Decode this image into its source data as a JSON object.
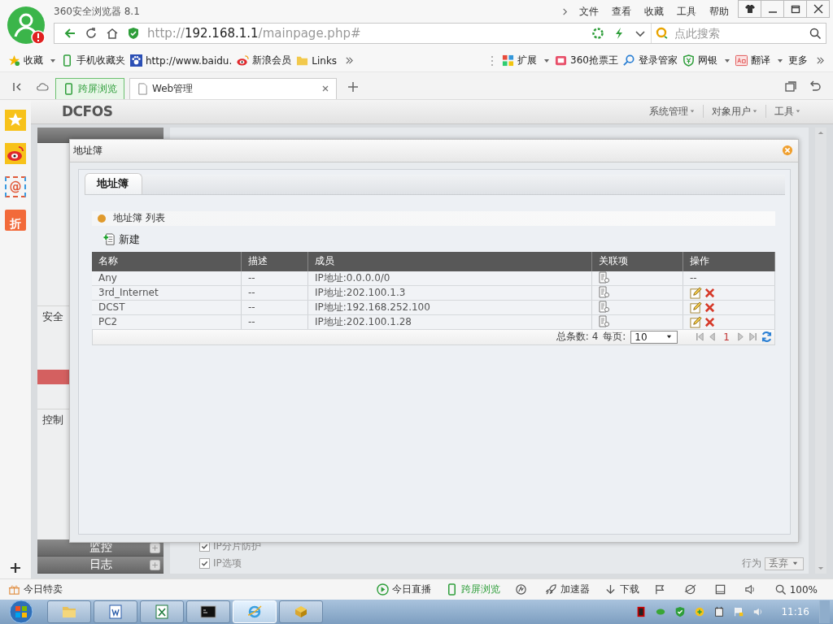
{
  "browser": {
    "title": "360安全浏览器 8.1",
    "menu": [
      "文件",
      "查看",
      "收藏",
      "工具",
      "帮助"
    ]
  },
  "address": {
    "scheme": "http://",
    "host": "192.168.1.1",
    "path": "/mainpage.php#"
  },
  "search": {
    "placeholder": "点此搜索"
  },
  "bookmarks": [
    {
      "label": "收藏",
      "kind": "favorites"
    },
    {
      "label": "手机收藏夹",
      "kind": "phone"
    },
    {
      "label": "http://www.baidu.",
      "kind": "paw"
    },
    {
      "label": "新浪会员",
      "kind": "weibo"
    },
    {
      "label": "Links",
      "kind": "folder"
    }
  ],
  "extensions": [
    {
      "label": "扩展",
      "kind": "apps"
    },
    {
      "label": "360抢票王",
      "kind": "ticket"
    },
    {
      "label": "登录管家",
      "kind": "key"
    },
    {
      "label": "网银",
      "kind": "bank"
    },
    {
      "label": "翻译",
      "kind": "translate"
    },
    {
      "label": "更多",
      "kind": "more"
    }
  ],
  "tabs": [
    {
      "label": "跨屏浏览",
      "kind": "phone",
      "selected": false
    },
    {
      "label": "Web管理",
      "kind": "page",
      "selected": true
    }
  ],
  "side_rail": [
    {
      "kind": "star"
    },
    {
      "kind": "weibo"
    },
    {
      "kind": "mail",
      "glyph": "@"
    },
    {
      "kind": "deal",
      "glyph": "折"
    }
  ],
  "webpage": {
    "logo": "DCFOS",
    "nav": [
      "系统管理",
      "对象用户",
      "工具"
    ],
    "sidebar": {
      "sections": [
        "安全",
        "控制"
      ],
      "bars": [
        "监控",
        "日志"
      ]
    },
    "options": [
      {
        "label": "IP分片防护",
        "checked": true
      },
      {
        "label": "IP选项",
        "checked": true
      }
    ],
    "action": {
      "label": "行为",
      "value": "丢弃"
    }
  },
  "dialog": {
    "title": "地址簿",
    "tab": "地址簿",
    "list_title": "地址簿 列表",
    "new_button": "新建",
    "table": {
      "columns": [
        "名称",
        "描述",
        "成员",
        "关联项",
        "操作"
      ],
      "rows": [
        {
          "name": "Any",
          "description": "--",
          "member": "IP地址:0.0.0.0/0",
          "editable": false,
          "operation": "--"
        },
        {
          "name": "3rd_Internet",
          "description": "--",
          "member": "IP地址:202.100.1.3",
          "editable": true
        },
        {
          "name": "DCST",
          "description": "--",
          "member": "IP地址:192.168.252.100",
          "editable": true
        },
        {
          "name": "PC2",
          "description": "--",
          "member": "IP地址:202.100.1.28",
          "editable": true
        }
      ]
    },
    "footer": {
      "total": "总条数: 4",
      "per_page_label": "每页:",
      "per_page": "10",
      "page": "1"
    }
  },
  "status_bar": {
    "left": "今日特卖",
    "items": [
      {
        "label": "今日直播",
        "kind": "play"
      },
      {
        "label": "跨屏浏览",
        "kind": "phone"
      },
      {
        "kind": "swirl"
      },
      {
        "label": "加速器",
        "kind": "rocket"
      },
      {
        "label": "下载",
        "kind": "download"
      },
      {
        "kind": "flag"
      },
      {
        "kind": "browser"
      },
      {
        "kind": "window"
      },
      {
        "kind": "speaker"
      },
      {
        "label": "100%",
        "kind": "zoom"
      }
    ]
  },
  "taskbar": {
    "apps": [
      {
        "kind": "folder",
        "selected": false
      },
      {
        "kind": "word",
        "selected": false
      },
      {
        "kind": "excel",
        "selected": false
      },
      {
        "kind": "cmd",
        "selected": false
      },
      {
        "kind": "ie",
        "selected": true
      },
      {
        "kind": "box",
        "selected": false
      }
    ],
    "clock": "11:16"
  }
}
